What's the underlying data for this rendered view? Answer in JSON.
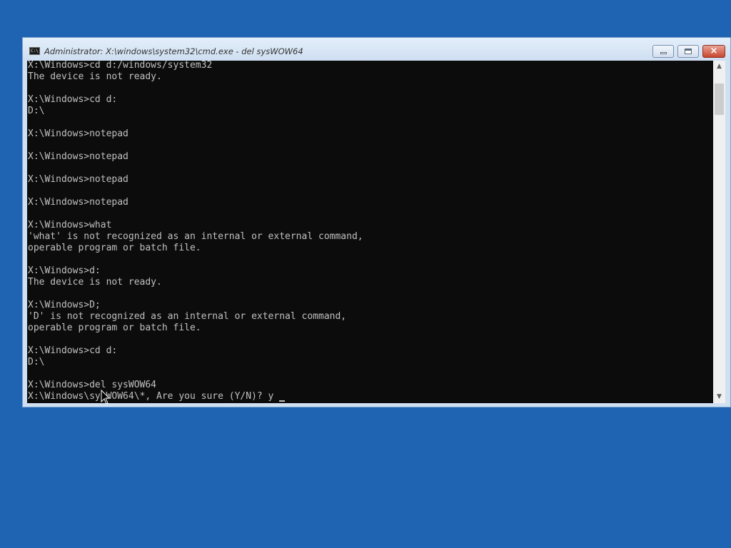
{
  "window": {
    "title": "Administrator: X:\\windows\\system32\\cmd.exe - del  sysWOW64",
    "icon": "cmd-icon",
    "icon_label": "C:\\",
    "buttons": {
      "minimize": "minimize-icon",
      "maximize": "maximize-icon",
      "close": "×"
    }
  },
  "console": {
    "lines": [
      "X:\\Windows>cd d:/windows/system32",
      "The device is not ready.",
      "",
      "X:\\Windows>cd d:",
      "D:\\",
      "",
      "X:\\Windows>notepad",
      "",
      "X:\\Windows>notepad",
      "",
      "X:\\Windows>notepad",
      "",
      "X:\\Windows>notepad",
      "",
      "X:\\Windows>what",
      "'what' is not recognized as an internal or external command,",
      "operable program or batch file.",
      "",
      "X:\\Windows>d:",
      "The device is not ready.",
      "",
      "X:\\Windows>D;",
      "'D' is not recognized as an internal or external command,",
      "operable program or batch file.",
      "",
      "X:\\Windows>cd d:",
      "D:\\",
      "",
      "X:\\Windows>del sysWOW64",
      "X:\\Windows\\sysWOW64\\*, Are you sure (Y/N)? y"
    ]
  },
  "scrollbar": {
    "up": "▲",
    "down": "▼"
  },
  "colors": {
    "desktop": "#1f64b3",
    "console_bg": "#0c0c0c",
    "console_text": "#c0c0c0"
  }
}
